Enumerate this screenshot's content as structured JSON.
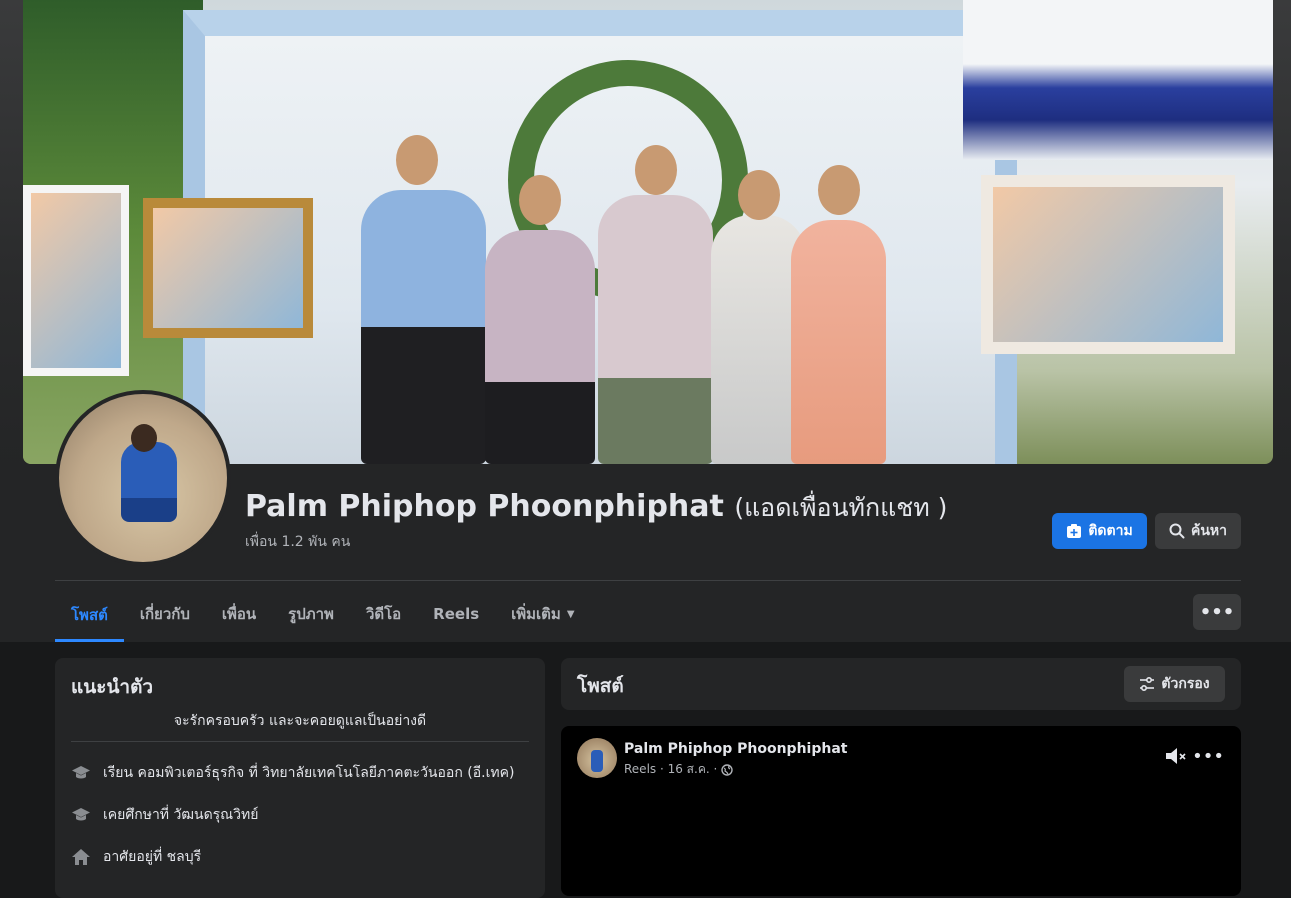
{
  "profile": {
    "name": "Palm Phiphop Phoonphiphat",
    "alternate_name": "(แอดเพื่อนทักแชท )",
    "friends": "เพื่อน 1.2 พัน คน"
  },
  "actions": {
    "follow_label": "ติดตาม",
    "search_label": "ค้นหา",
    "more_icon": "more-horizontal-icon"
  },
  "tabs": [
    {
      "label": "โพสต์",
      "active": true
    },
    {
      "label": "เกี่ยวกับ"
    },
    {
      "label": "เพื่อน"
    },
    {
      "label": "รูปภาพ"
    },
    {
      "label": "วิดีโอ"
    },
    {
      "label": "Reels"
    },
    {
      "label": "เพิ่มเติม"
    }
  ],
  "intro": {
    "title": "แนะนำตัว",
    "bio": "จะรักครอบครัว และจะคอยดูแลเป็นอย่างดี",
    "items": [
      {
        "icon": "graduation-cap-icon",
        "text": "เรียน คอมพิวเตอร์ธุรกิจ ที่ วิทยาลัยเทคโนโลยีภาคตะวันออก (อี.เทค)"
      },
      {
        "icon": "graduation-cap-icon",
        "text": "เคยศึกษาที่ วัฒนดรุณวิทย์"
      },
      {
        "icon": "home-icon",
        "text": "อาศัยอยู่ที่ ชลบุรี"
      }
    ]
  },
  "posts": {
    "title": "โพสต์",
    "filter_label": "ตัวกรอง",
    "first_post": {
      "author": "Palm Phiphop Phoonphiphat",
      "meta": "Reels · 16 ส.ค. ·",
      "privacy_icon": "globe-icon"
    }
  },
  "colors": {
    "accent": "#2d88ff",
    "follow_button": "#1b74e4",
    "surface": "#242526",
    "background": "#18191a"
  }
}
